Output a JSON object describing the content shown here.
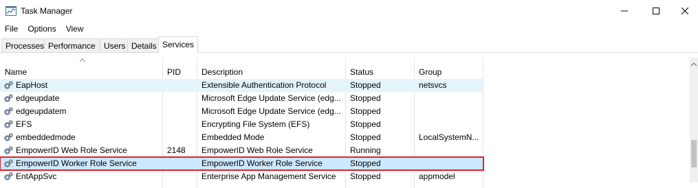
{
  "window": {
    "title": "Task Manager"
  },
  "menu": [
    "File",
    "Options",
    "View"
  ],
  "tabs": [
    "Processes",
    "Performance",
    "Users",
    "Details",
    "Services"
  ],
  "active_tab": "Services",
  "columns": {
    "name": "Name",
    "pid": "PID",
    "description": "Description",
    "status": "Status",
    "group": "Group"
  },
  "sorted_column": "Name",
  "rows": [
    {
      "name": "EapHost",
      "pid": "",
      "description": "Extensible Authentication Protocol",
      "status": "Stopped",
      "group": "netsvcs"
    },
    {
      "name": "edgeupdate",
      "pid": "",
      "description": "Microsoft Edge Update Service (edg...",
      "status": "Stopped",
      "group": ""
    },
    {
      "name": "edgeupdatem",
      "pid": "",
      "description": "Microsoft Edge Update Service (edg...",
      "status": "Stopped",
      "group": ""
    },
    {
      "name": "EFS",
      "pid": "",
      "description": "Encrypting File System (EFS)",
      "status": "Stopped",
      "group": ""
    },
    {
      "name": "embeddedmode",
      "pid": "",
      "description": "Embedded Mode",
      "status": "Stopped",
      "group": "LocalSystemN..."
    },
    {
      "name": "EmpowerID Web Role Service",
      "pid": "2148",
      "description": "EmpowerID Web Role Service",
      "status": "Running",
      "group": ""
    },
    {
      "name": "EmpowerID Worker Role Service",
      "pid": "",
      "description": "EmpowerID Worker Role Service",
      "status": "Stopped",
      "group": ""
    },
    {
      "name": "EntAppSvc",
      "pid": "",
      "description": "Enterprise App Management Service",
      "status": "Stopped",
      "group": "appmodel"
    }
  ],
  "selected_row": "EmpowerID Worker Role Service",
  "hovered_row": "EapHost",
  "colors": {
    "selection": "#cce8ff",
    "hover": "#e5f3fb",
    "highlight_border": "#e0202a"
  },
  "icons": {
    "app": "task-manager-icon",
    "service": "gear-icon"
  }
}
